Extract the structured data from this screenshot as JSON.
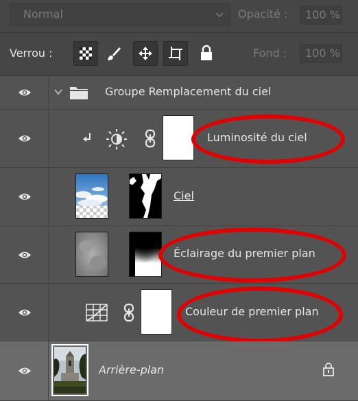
{
  "panel": {
    "blend_mode": "Normal",
    "opacity_label": "Opacité :",
    "opacity_value": "100 %",
    "lock_label": "Verrou :",
    "fill_label": "Fond :",
    "fill_value": "100 %"
  },
  "layers": [
    {
      "name": "Groupe Remplacement du ciel",
      "type": "group",
      "visible": true,
      "expanded": true
    },
    {
      "name": "Luminosité du ciel",
      "type": "brightness-adjustment",
      "visible": true,
      "clipped": true
    },
    {
      "name": "Ciel",
      "type": "image-with-mask",
      "visible": true
    },
    {
      "name": "Éclairage du premier plan",
      "type": "image-with-mask",
      "visible": true
    },
    {
      "name": "Couleur de premier plan",
      "type": "fill-layer",
      "visible": true
    },
    {
      "name": "Arrière-plan",
      "type": "background",
      "visible": true,
      "locked": true,
      "selected": true
    }
  ],
  "highlight_color": "#e30000"
}
